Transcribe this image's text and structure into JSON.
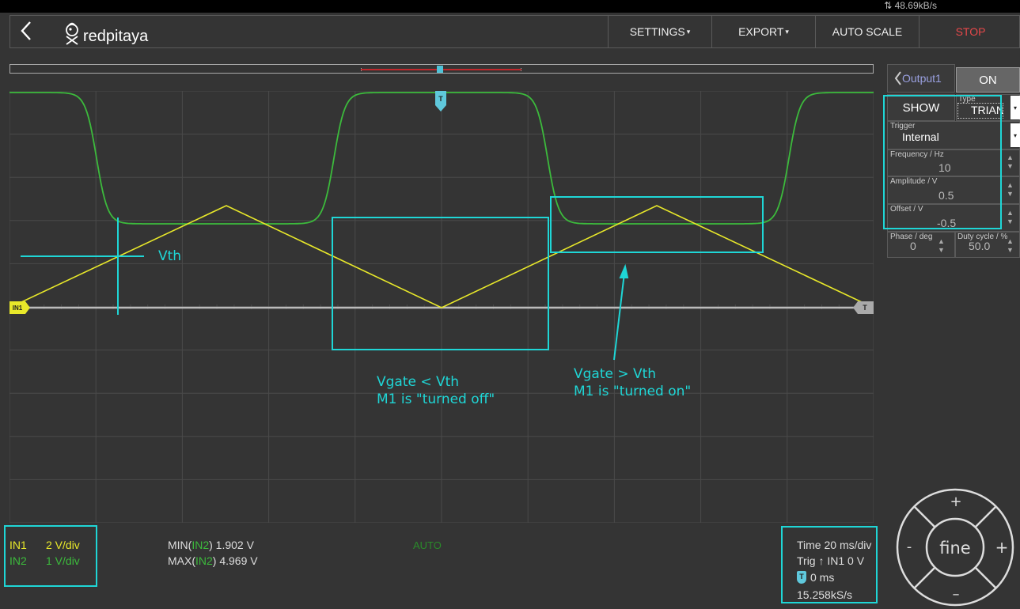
{
  "status": {
    "data_rate": "48.69kB/s"
  },
  "nav": {
    "logo_text": "redpitaya",
    "settings": "SETTINGS",
    "export": "EXPORT",
    "autoscale": "AUTO SCALE",
    "stop": "STOP"
  },
  "output": {
    "tab": "Output1",
    "on_label": "ON",
    "show_label": "SHOW",
    "type_label": "Type",
    "type_value": "TRIAN",
    "trigger_label": "Trigger",
    "trigger_value": "Internal",
    "freq_label": "Frequency / Hz",
    "freq_value": "10",
    "amp_label": "Amplitude / V",
    "amp_value": "0.5",
    "offset_label": "Offset / V",
    "offset_value": "-0.5",
    "phase_label": "Phase / deg",
    "phase_value": "0",
    "duty_label": "Duty cycle / %",
    "duty_value": "50.0"
  },
  "channels": {
    "in1_label": "IN1",
    "in1_scale": "2 V/div",
    "in2_label": "IN2",
    "in2_scale": "1 V/div",
    "in1_marker": "IN1",
    "trigger_marker": "T"
  },
  "measurements": {
    "min_prefix": "MIN(",
    "min_ch": "IN2",
    "min_suffix": ") 1.902 V",
    "max_prefix": "MAX(",
    "max_ch": "IN2",
    "max_suffix": ") 4.969 V",
    "mode": "AUTO"
  },
  "timebase": {
    "time": "Time 20 ms/div",
    "trig": "Trig ↑ IN1 0 V",
    "offset_icon": "T",
    "offset": "0 ms",
    "sample_rate": "15.258kS/s"
  },
  "annotations": {
    "vth": "Vth",
    "off_line1": "Vgate < Vth",
    "off_line2": "M1 is \"turned off\"",
    "on_line1": "Vgate > Vth",
    "on_line2": "M1 is \"turned on\""
  },
  "dpad": {
    "center": "fine",
    "up": "+",
    "down": "–",
    "left": "-",
    "right": "+"
  },
  "colors": {
    "in1": "#e8e82a",
    "in2": "#3cba3c",
    "annotation": "#1fd6d6",
    "stop": "#e8484a",
    "trigger": "#5fc8dc"
  },
  "icons": {
    "back": "chevron-left-icon",
    "data_rate": "transfer-arrows-icon"
  }
}
